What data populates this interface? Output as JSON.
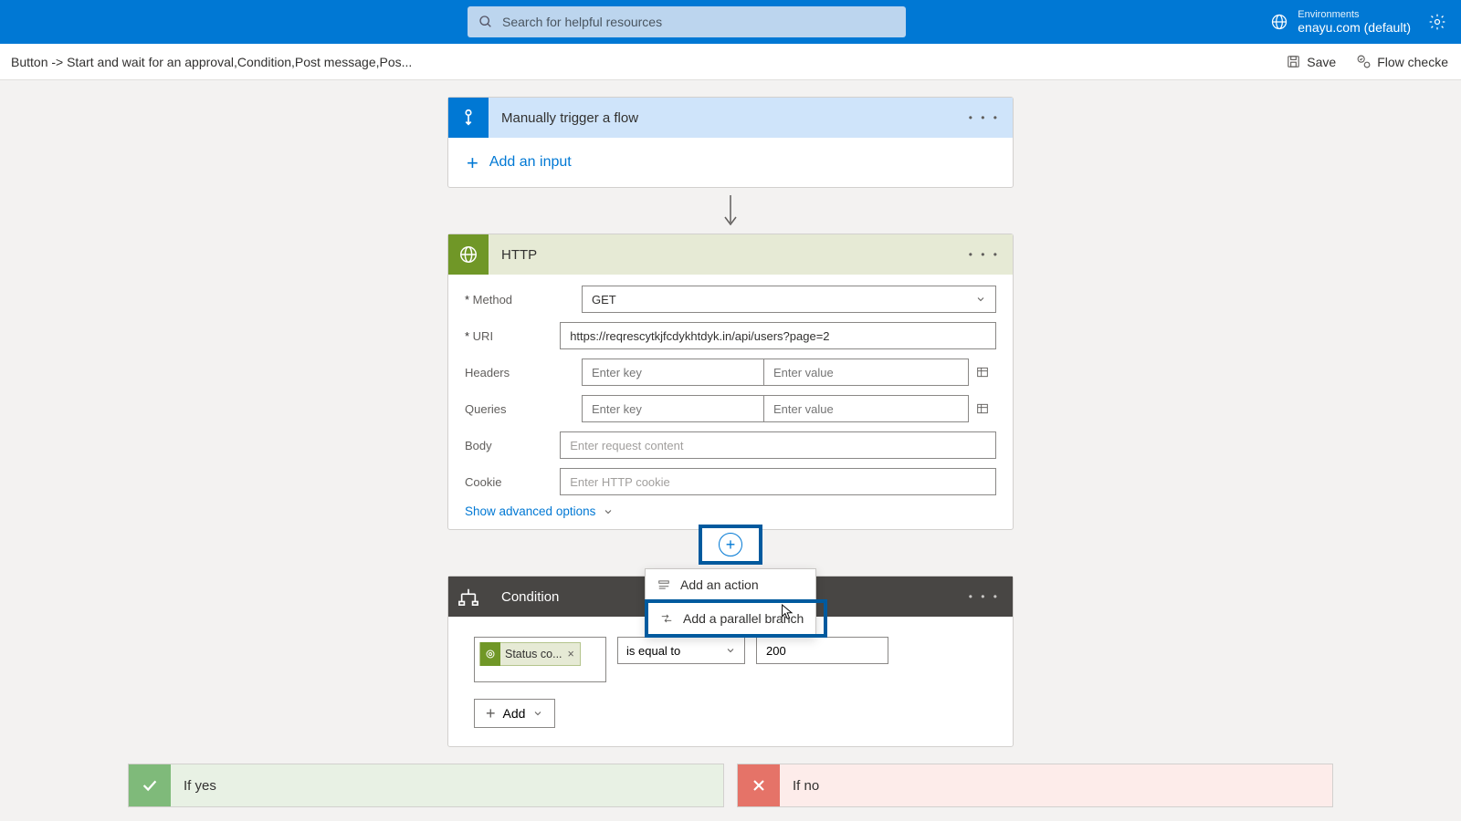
{
  "header": {
    "search_placeholder": "Search for helpful resources",
    "env_label": "Environments",
    "env_name": "enayu.com (default)"
  },
  "toolbar": {
    "breadcrumb": "Button -> Start and wait for an approval,Condition,Post message,Pos...",
    "save_label": "Save",
    "checker_label": "Flow checke"
  },
  "trigger": {
    "title": "Manually trigger a flow",
    "add_input_label": "Add an input"
  },
  "http": {
    "title": "HTTP",
    "method_label": "Method",
    "method_value": "GET",
    "uri_label": "URI",
    "uri_value": "https://reqrescytkjfcdykhtdyk.in/api/users?page=2",
    "headers_label": "Headers",
    "key_placeholder": "Enter key",
    "value_placeholder": "Enter value",
    "queries_label": "Queries",
    "body_label": "Body",
    "body_placeholder": "Enter request content",
    "cookie_label": "Cookie",
    "cookie_placeholder": "Enter HTTP cookie",
    "advanced_label": "Show advanced options"
  },
  "popover": {
    "add_action": "Add an action",
    "add_parallel": "Add a parallel branch"
  },
  "condition": {
    "title": "Condition",
    "token_label": "Status co...",
    "operator": "is equal to",
    "value": "200",
    "add_label": "Add"
  },
  "branches": {
    "yes": "If yes",
    "no": "If no"
  }
}
